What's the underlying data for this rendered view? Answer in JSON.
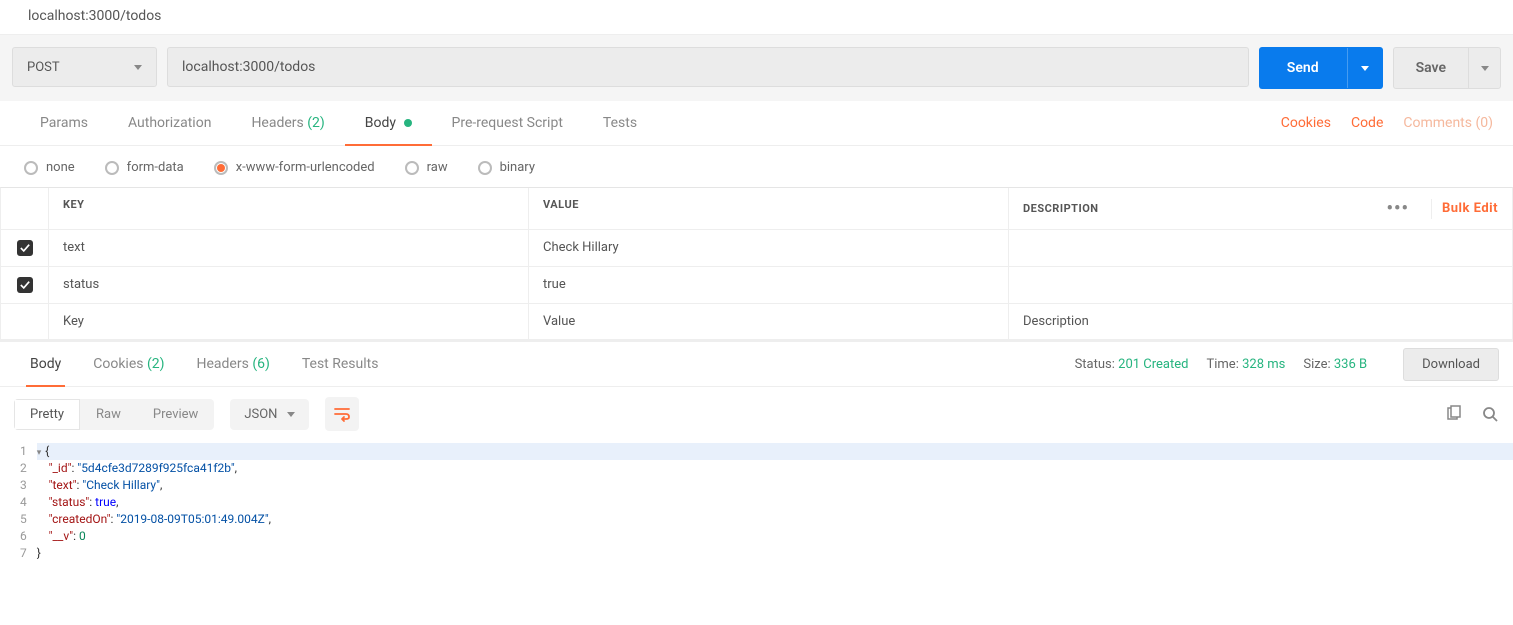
{
  "url_display": "localhost:3000/todos",
  "request": {
    "method": "POST",
    "url": "localhost:3000/todos",
    "send_label": "Send",
    "save_label": "Save"
  },
  "req_tabs": {
    "params": "Params",
    "auth": "Authorization",
    "headers": "Headers",
    "headers_count": "(2)",
    "body": "Body",
    "prerequest": "Pre-request Script",
    "tests": "Tests",
    "cookies": "Cookies",
    "code": "Code",
    "comments": "Comments (0)"
  },
  "body_types": {
    "none": "none",
    "formdata": "form-data",
    "urlencoded": "x-www-form-urlencoded",
    "raw": "raw",
    "binary": "binary"
  },
  "kv": {
    "key_header": "KEY",
    "value_header": "VALUE",
    "desc_header": "DESCRIPTION",
    "bulk_edit": "Bulk Edit",
    "rows": [
      {
        "checked": true,
        "key": "text",
        "value": "Check Hillary",
        "desc": ""
      },
      {
        "checked": true,
        "key": "status",
        "value": "true",
        "desc": ""
      }
    ],
    "ph_key": "Key",
    "ph_value": "Value",
    "ph_desc": "Description"
  },
  "response": {
    "tabs": {
      "body": "Body",
      "cookies": "Cookies",
      "cookies_count": "(2)",
      "headers": "Headers",
      "headers_count": "(6)",
      "tests": "Test Results"
    },
    "status_label": "Status:",
    "status_value": "201 Created",
    "time_label": "Time:",
    "time_value": "328 ms",
    "size_label": "Size:",
    "size_value": "336 B",
    "download": "Download"
  },
  "viewer": {
    "pretty": "Pretty",
    "raw": "Raw",
    "preview": "Preview",
    "type": "JSON"
  },
  "json_body": {
    "_id": "5d4cfe3d7289f925fca41f2b",
    "text": "Check Hillary",
    "status": true,
    "createdOn": "2019-08-09T05:01:49.004Z",
    "__v": 0
  },
  "code_lines": {
    "l1": "1",
    "l2": "2",
    "l3": "3",
    "l4": "4",
    "l5": "5",
    "l6": "6",
    "l7": "7"
  }
}
